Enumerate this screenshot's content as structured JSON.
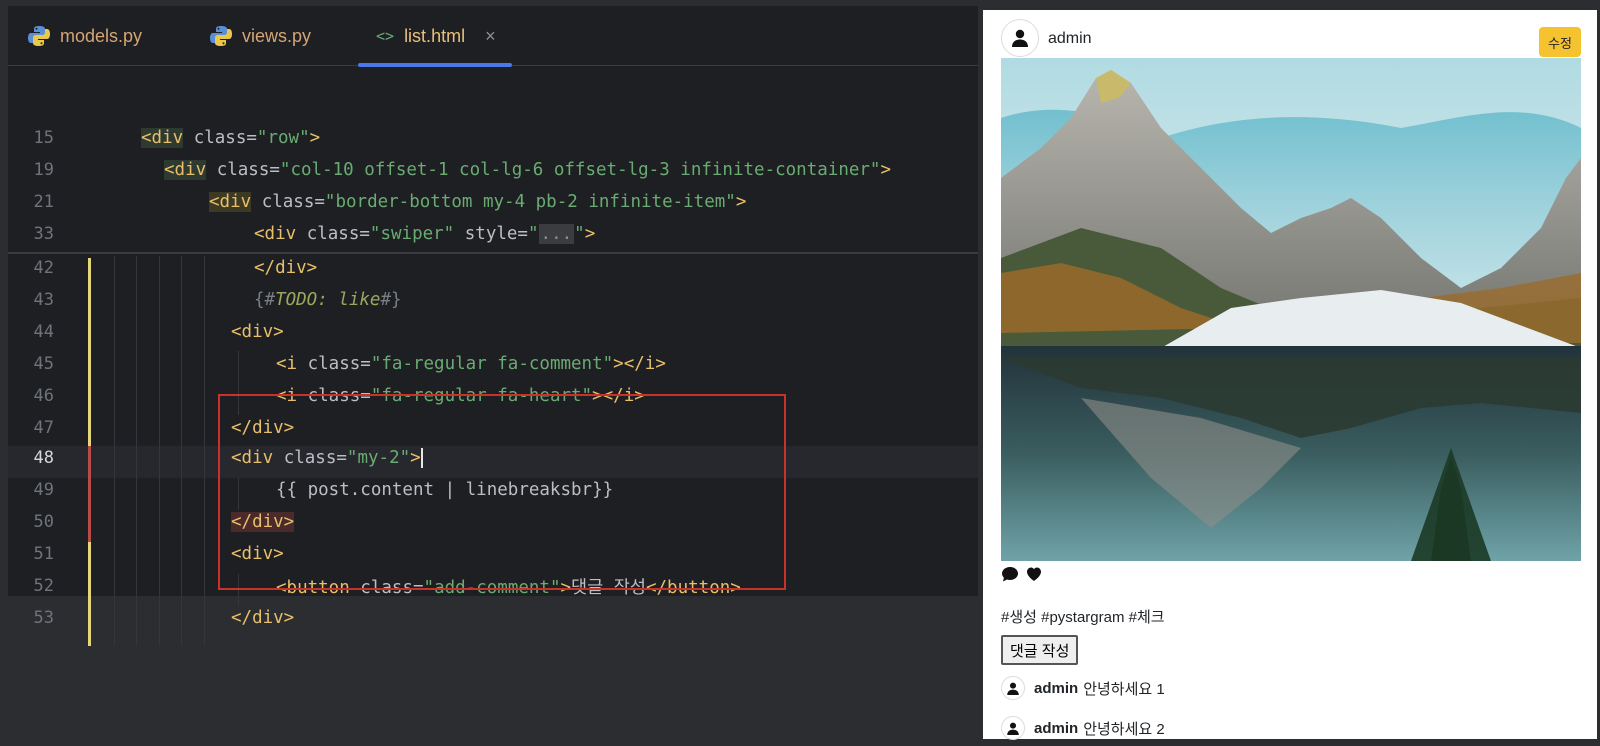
{
  "tabs": [
    {
      "label": "models.py",
      "icon": "python-icon"
    },
    {
      "label": "views.py",
      "icon": "python-icon"
    },
    {
      "label": "list.html",
      "icon": "html-brackets-icon",
      "active": true,
      "close": "×"
    }
  ],
  "html_icon_glyph": "<>",
  "code": {
    "lines": [
      {
        "n": "15",
        "parts": [
          [
            "tg",
            "<div"
          ],
          [
            "at",
            " class="
          ],
          [
            "st",
            "\"row\""
          ],
          [
            "tg",
            ">"
          ]
        ]
      },
      {
        "n": "19",
        "parts": [
          [
            "tg",
            "<div"
          ],
          [
            "at",
            " class="
          ],
          [
            "st",
            "\"col-10 offset-1 col-lg-6 offset-lg-3 infinite-container\""
          ],
          [
            "tg",
            ">"
          ]
        ]
      },
      {
        "n": "21",
        "parts": [
          [
            "tg",
            "<div"
          ],
          [
            "at",
            " class="
          ],
          [
            "st",
            "\"border-bottom my-4 pb-2 infinite-item\""
          ],
          [
            "tg",
            ">"
          ]
        ]
      },
      {
        "n": "33",
        "parts": [
          [
            "tg",
            "<div"
          ],
          [
            "at",
            " class="
          ],
          [
            "st",
            "\"swiper\""
          ],
          [
            "at",
            " style="
          ],
          [
            "st",
            "\""
          ],
          [
            "fd",
            "..."
          ],
          [
            "st",
            "\""
          ],
          [
            "tg",
            ">"
          ]
        ]
      },
      {
        "n": "42",
        "parts": [
          [
            "tg",
            "</div>"
          ]
        ]
      },
      {
        "n": "43",
        "parts": [
          [
            "cm",
            "{#"
          ],
          [
            "cmi",
            "TODO: like"
          ],
          [
            "cm",
            "#}"
          ]
        ]
      },
      {
        "n": "44",
        "parts": [
          [
            "tg",
            "<div>"
          ]
        ]
      },
      {
        "n": "45",
        "parts": [
          [
            "tg",
            "<i"
          ],
          [
            "at",
            " class="
          ],
          [
            "st",
            "\"fa-regular fa-comment\""
          ],
          [
            "tg",
            "></i>"
          ]
        ]
      },
      {
        "n": "46",
        "parts": [
          [
            "tg",
            "<i"
          ],
          [
            "at",
            " class="
          ],
          [
            "st",
            "\"fa-regular fa-heart\""
          ],
          [
            "tg",
            "></i>"
          ]
        ]
      },
      {
        "n": "47",
        "parts": [
          [
            "tg",
            "</div>"
          ]
        ]
      },
      {
        "n": "48",
        "parts": [
          [
            "tg",
            "<div"
          ],
          [
            "at",
            " class="
          ],
          [
            "st",
            "\"my-2\""
          ],
          [
            "tg",
            ">"
          ]
        ]
      },
      {
        "n": "49",
        "parts": [
          [
            "kr",
            "{{ post.content | linebreaksbr}}"
          ]
        ]
      },
      {
        "n": "50",
        "parts": [
          [
            "tg",
            "</div>"
          ]
        ]
      },
      {
        "n": "51",
        "parts": [
          [
            "tg",
            "<div>"
          ]
        ]
      },
      {
        "n": "52",
        "parts": [
          [
            "tg",
            "<button"
          ],
          [
            "at",
            " class="
          ],
          [
            "st",
            "\"add-comment\""
          ],
          [
            "tg",
            ">"
          ],
          [
            "kr",
            "댓글 작성"
          ],
          [
            "tg",
            "</button>"
          ]
        ]
      },
      {
        "n": "53",
        "parts": [
          [
            "tg",
            "</div>"
          ]
        ]
      }
    ]
  },
  "preview": {
    "username": "admin",
    "edit_label": "수정",
    "tags": "#생성 #pystargram #체크",
    "comment_button": "댓글 작성",
    "comments": [
      {
        "user": "admin",
        "text": "안녕하세요 1"
      },
      {
        "user": "admin",
        "text": "안녕하세요 2"
      }
    ]
  }
}
